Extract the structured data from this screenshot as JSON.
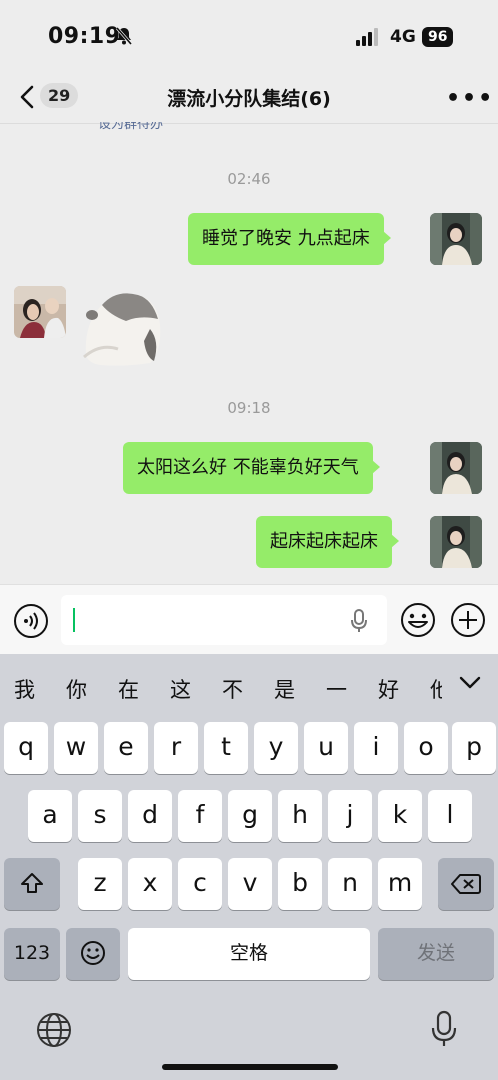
{
  "status_bar": {
    "time": "09:19",
    "network": "4G",
    "battery": "96"
  },
  "nav": {
    "unread_count": "29",
    "title": "漂流小分队集结(6)"
  },
  "partial_note": "设为群待办",
  "messages": {
    "ts1": "02:46",
    "msg1": "睡觉了晚安 九点起床",
    "ts2": "09:18",
    "msg2": "太阳这么好 不能辜负好天气",
    "msg3": "起床起床起床"
  },
  "input": {
    "value": ""
  },
  "keyboard": {
    "candidates": [
      "我",
      "你",
      "在",
      "这",
      "不",
      "是",
      "一",
      "好",
      "他"
    ],
    "row1": [
      "q",
      "w",
      "e",
      "r",
      "t",
      "y",
      "u",
      "i",
      "o",
      "p"
    ],
    "row2": [
      "a",
      "s",
      "d",
      "f",
      "g",
      "h",
      "j",
      "k",
      "l"
    ],
    "row3": [
      "z",
      "x",
      "c",
      "v",
      "b",
      "n",
      "m"
    ],
    "numbers_key": "123",
    "space_key": "空格",
    "send_key": "发送"
  },
  "colors": {
    "bubble": "#95ec69",
    "background": "#ededed",
    "keyboard": "#d1d3d9"
  }
}
